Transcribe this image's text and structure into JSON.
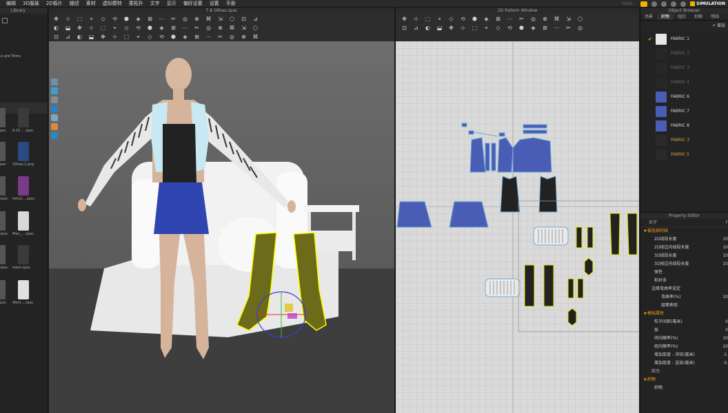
{
  "menubar": {
    "items": [
      "编辑",
      "3D服装",
      "2D板片",
      "缝纫",
      "素材",
      "虚拟模特",
      "重拓扑",
      "文字",
      "显示",
      "偏好设置",
      "设置",
      "手册"
    ],
    "hello_text": "Hello...",
    "simulation_label": "SIMULATION"
  },
  "library": {
    "title": "Library",
    "folder_label": "e and Trims",
    "items": [
      {
        "caption": "6.29 ....zpac"
      },
      {
        "caption": "18hao.1.png"
      },
      {
        "caption": "hefu2....zpac"
      },
      {
        "caption": "Men_....zpac"
      },
      {
        "caption": "wash.zpac"
      },
      {
        "caption": "Wom....zpac"
      }
    ],
    "left_captions": [
      "pac",
      "pac",
      "zpac",
      "zpac",
      "zpac",
      "pac"
    ]
  },
  "window3d": {
    "title": "7.8 18hao.zpac"
  },
  "window2d": {
    "title": "2D Pattern Window"
  },
  "object_browser": {
    "title": "Object Browser",
    "tabs": [
      "场景",
      "织物",
      "纽扣",
      "扣眼",
      "明线"
    ],
    "active_tab": 1,
    "add_label": "+ 增加",
    "fabrics": [
      {
        "name": "FABRIC 1",
        "color": "#e6e6e6",
        "checked": true,
        "style": "normal"
      },
      {
        "name": "FABRIC 2",
        "color": "#2a2a2a",
        "checked": false,
        "style": "dim"
      },
      {
        "name": "FABRIC 3",
        "color": "#2a2a2a",
        "checked": false,
        "style": "dim"
      },
      {
        "name": "FABRIC 4",
        "color": "#2a2a2a",
        "checked": false,
        "style": "dim"
      },
      {
        "name": "FABRIC 6",
        "color": "#4a5db5",
        "checked": false,
        "style": "normal"
      },
      {
        "name": "FABRIC 7",
        "color": "#4a5db5",
        "checked": false,
        "style": "normal"
      },
      {
        "name": "FABRIC 8",
        "color": "#4a5db5",
        "checked": false,
        "style": "normal"
      },
      {
        "name": "FABRIC 3",
        "color": "#2a2a2a",
        "checked": false,
        "style": "orange"
      },
      {
        "name": "FABRIC 5",
        "color": "#2a2a2a",
        "checked": false,
        "style": "orange"
      }
    ]
  },
  "property_editor": {
    "title": "Property Editor",
    "name_label": "名字",
    "name_value": "F",
    "rows": [
      {
        "label": "被选择的线",
        "value": "",
        "section": true
      },
      {
        "label": "2D线段长度",
        "value": "10",
        "section": false
      },
      {
        "label": "2D按边内线段长度",
        "value": "10",
        "section": false
      },
      {
        "label": "3D线段长度",
        "value": "10",
        "section": false
      },
      {
        "label": "3D按边内线段长度",
        "value": "10",
        "section": false
      },
      {
        "label": "弹性",
        "value": "",
        "section": false
      },
      {
        "label": "粘衬条",
        "value": "",
        "section": false
      },
      {
        "label": "边缘弯曲率设定",
        "value": "",
        "section": false
      },
      {
        "label": "弯曲率(%)",
        "value": "10",
        "section": false
      },
      {
        "label": "层面表现",
        "value": "",
        "section": false
      },
      {
        "label": "模拟属性",
        "value": "",
        "section": true
      },
      {
        "label": "粒子间距(毫米)",
        "value": "0",
        "section": false
      },
      {
        "label": "层",
        "value": "0",
        "section": false
      },
      {
        "label": "纬向缩率(%)",
        "value": "10",
        "section": false
      },
      {
        "label": "经向缩率(%)",
        "value": "10",
        "section": false
      },
      {
        "label": "增加厚度 - 冲突(毫米)",
        "value": "2.",
        "section": false
      },
      {
        "label": "增加厚度 - 渲染(毫米)",
        "value": "0.",
        "section": false
      },
      {
        "label": "压力",
        "value": "",
        "section": false
      },
      {
        "label": "织物",
        "value": "",
        "section": true
      },
      {
        "label": "织物",
        "value": "",
        "section": false
      }
    ]
  }
}
